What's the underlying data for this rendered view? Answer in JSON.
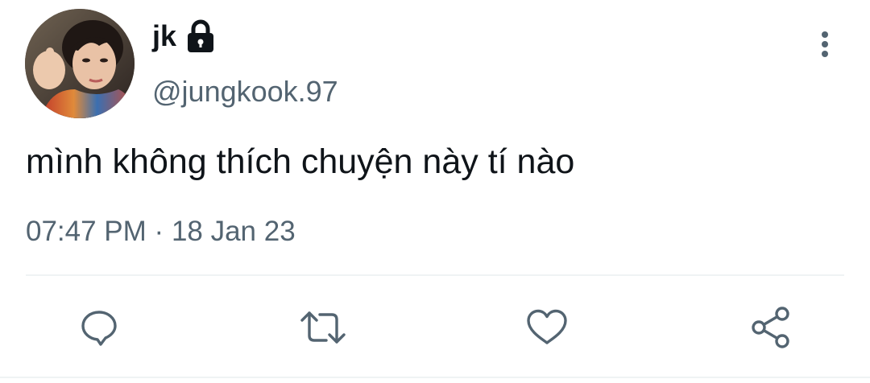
{
  "user": {
    "display_name": "jk",
    "handle": "@jungkook.97",
    "protected_icon": "lock-icon",
    "avatar_icon": "profile-photo"
  },
  "tweet": {
    "text": "mình không thích chuyện này tí nào",
    "time": "07:47 PM",
    "separator": "·",
    "date": "18 Jan 23"
  },
  "actions": {
    "more": "more-vertical-icon",
    "reply": "reply-icon",
    "retweet": "retweet-icon",
    "like": "heart-icon",
    "share": "share-icon"
  },
  "colors": {
    "text_primary": "#0f1419",
    "text_secondary": "#536471",
    "divider": "#eff3f4"
  }
}
